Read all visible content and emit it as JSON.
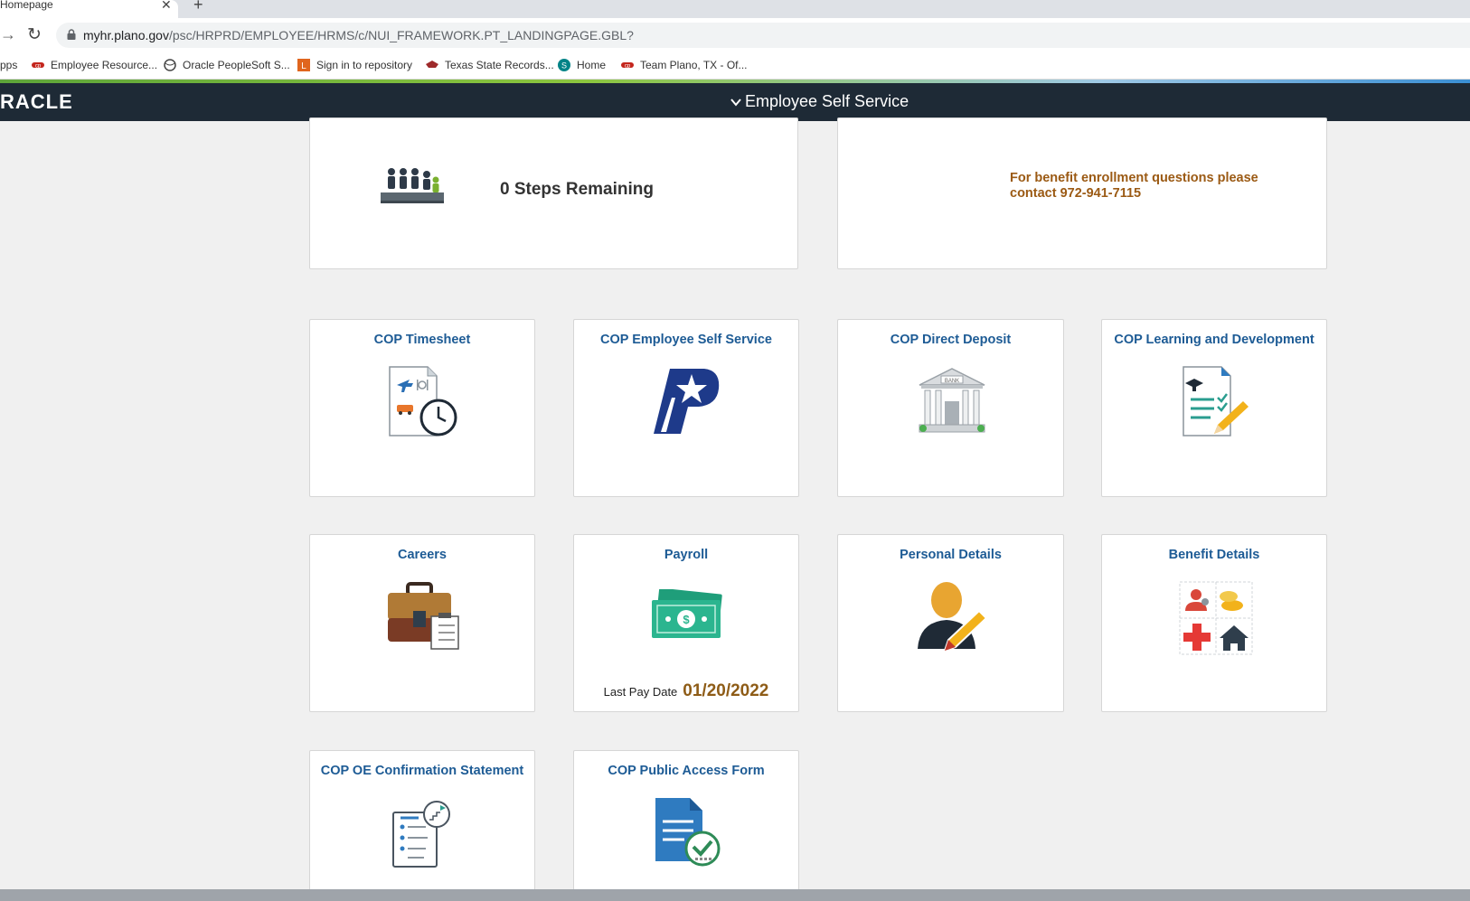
{
  "browser": {
    "tab_title": "Homepage",
    "tab_close": "✕",
    "new_tab": "+",
    "url_host": "myhr.plano.gov",
    "url_path": "/psc/HRPRD/EMPLOYEE/HRMS/c/NUI_FRAMEWORK.PT_LANDINGPAGE.GBL?",
    "bookmarks": [
      {
        "label": "pps"
      },
      {
        "label": "Employee Resource..."
      },
      {
        "label": "Oracle PeopleSoft S..."
      },
      {
        "label": "Sign in to repository"
      },
      {
        "label": "Texas State Records..."
      },
      {
        "label": "Home"
      },
      {
        "label": "Team Plano, TX - Of..."
      }
    ]
  },
  "banner": {
    "logo": "RACLE",
    "title": "Employee Self Service",
    "chevron": "⌄"
  },
  "tiles": {
    "onboarding": {
      "steps": "0 Steps Remaining"
    },
    "benefits_enrollment": {
      "note": "For benefit enrollment questions please contact 972-941-7115"
    },
    "timesheet": {
      "title": "COP Timesheet"
    },
    "ess": {
      "title": "COP Employee Self Service"
    },
    "direct_deposit": {
      "title": "COP Direct Deposit",
      "bank_label": "BANK"
    },
    "learning": {
      "title": "COP Learning and Development"
    },
    "careers": {
      "title": "Careers"
    },
    "payroll": {
      "title": "Payroll",
      "last_pay_label": "Last Pay Date",
      "last_pay_date": "01/20/2022",
      "bill_symbol": "$"
    },
    "personal": {
      "title": "Personal Details"
    },
    "benefit_details": {
      "title": "Benefit Details"
    },
    "oe_confirmation": {
      "title": "COP OE Confirmation Statement"
    },
    "public_access": {
      "title": "COP Public Access Form"
    }
  },
  "colors": {
    "banner_bg": "#1e2a36",
    "tile_title": "#1d5b95",
    "accent_brown": "#9b5a14"
  }
}
